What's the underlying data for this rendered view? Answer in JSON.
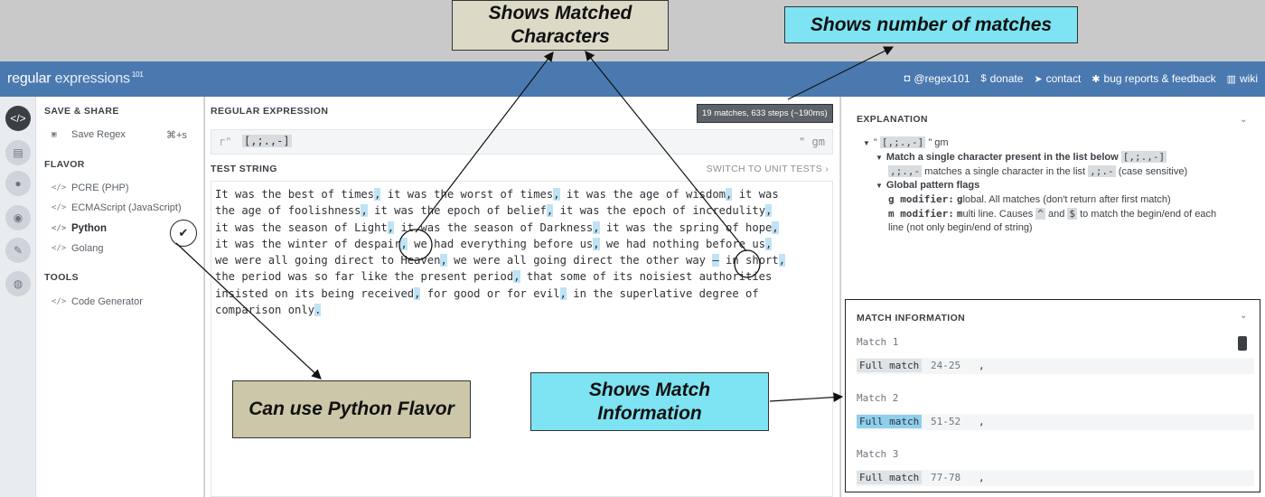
{
  "header": {
    "logo_main": "regular",
    "logo_thin": "expressions",
    "logo_sup": "101",
    "nav": [
      {
        "icon": "twitter-icon",
        "label": "@regex101"
      },
      {
        "icon": "dollar-icon",
        "label": "donate"
      },
      {
        "icon": "paper-plane-icon",
        "label": "contact"
      },
      {
        "icon": "bug-icon",
        "label": "bug reports & feedback"
      },
      {
        "icon": "bank-icon",
        "label": "wiki"
      }
    ]
  },
  "sidebar": {
    "save_share_title": "SAVE & SHARE",
    "save_regex": "Save Regex",
    "save_shortcut": "⌘+s",
    "flavor_title": "FLAVOR",
    "flavors": [
      "PCRE (PHP)",
      "ECMAScript (JavaScript)",
      "Python",
      "Golang"
    ],
    "selected_flavor": "Python",
    "tools_title": "TOOLS",
    "code_generator": "Code Generator"
  },
  "regex": {
    "section_title": "REGULAR EXPRESSION",
    "prefix": "r\"",
    "value": "[,;.,-]",
    "suffix": "\"",
    "flags": "gm",
    "match_summary": "19 matches, 633 steps (~190ms)"
  },
  "test": {
    "section_title": "TEST STRING",
    "switch_link": "SWITCH TO UNIT TESTS ›",
    "lines": [
      [
        "It was the best of times",
        ",",
        " it was the worst of times",
        ",",
        " it was the age of wisdom",
        ",",
        " it was"
      ],
      [
        "the age of foolishness",
        ",",
        " it was the epoch of belief",
        ",",
        " it was the epoch of incredulity",
        ","
      ],
      [
        "it was the season of Light",
        ",",
        " it was the season of Darkness",
        ",",
        " it was the spring of hope",
        ","
      ],
      [
        "it was the winter of despair",
        ",",
        " we had everything before us",
        ",",
        " we had nothing before us",
        ","
      ],
      [
        "we were all going direct to Heaven",
        ",",
        " we were all going direct the other way ",
        "—",
        " in short",
        ","
      ],
      [
        "the period was so far like the present period",
        ",",
        " that some of its noisiest authorities"
      ],
      [
        "insisted on its being received",
        ",",
        " for good or for evil",
        ",",
        " in the superlative degree of"
      ],
      [
        "comparison only",
        "."
      ]
    ]
  },
  "explanation": {
    "title": "EXPLANATION",
    "line1_open": "\"",
    "line1_token": "[,;.,-]",
    "line1_close": "\" gm",
    "match_single_title": "Match a single character present in the list below",
    "match_single_token": "[,;.,-]",
    "list_chars": ",;.,-",
    "list_desc": "matches a single character in the list",
    "list_chars2": ",;.-",
    "case_note": "(case sensitive)",
    "global_flags_title": "Global pattern flags",
    "g_mod": "g modifier:",
    "g_first": "g",
    "g_desc": "lobal. All matches (don't return after first match)",
    "m_mod": "m modifier:",
    "m_first": "m",
    "m_desc1": "ulti line. Causes",
    "caret": "^",
    "m_and": "and",
    "dollar": "$",
    "m_desc2": "to match the begin/end of each",
    "m_desc3": "line (not only begin/end of string)"
  },
  "match_info": {
    "title": "MATCH INFORMATION",
    "matches": [
      {
        "label": "Match 1",
        "kind": "Full match",
        "range": "24-25",
        "value": ","
      },
      {
        "label": "Match 2",
        "kind": "Full match",
        "range": "51-52",
        "value": ","
      },
      {
        "label": "Match 3",
        "kind": "Full match",
        "range": "77-78",
        "value": ","
      }
    ]
  },
  "callouts": {
    "matched_chars": [
      "Shows Matched",
      "Characters"
    ],
    "num_matches": "Shows number of matches",
    "python_flavor": "Can use Python Flavor",
    "match_info": [
      "Shows Match",
      "Information"
    ]
  },
  "colors": {
    "header_bg": "#4a79b0",
    "highlight": "#bfe3f5",
    "callout_cyan": "#7ee3f2",
    "callout_tan": "#dcdac7"
  }
}
